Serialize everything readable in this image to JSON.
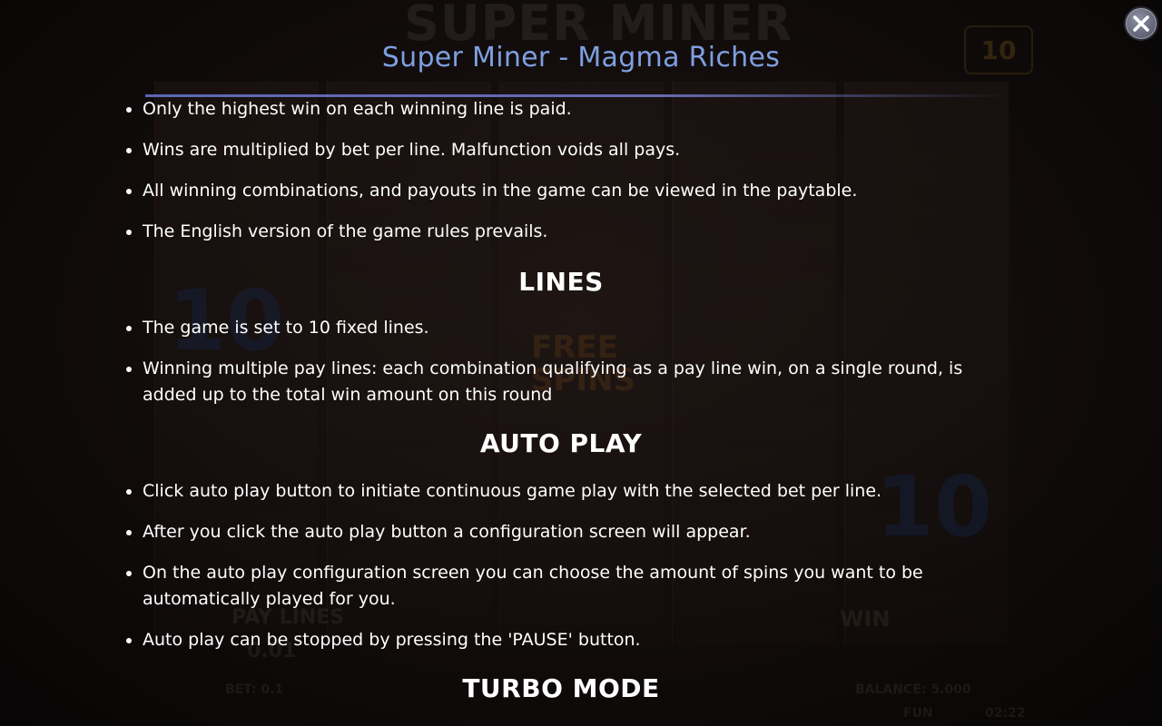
{
  "header": {
    "title": "Super Miner - Magma Riches"
  },
  "close_icon": "close-icon",
  "intro_rules": [
    "Only the highest win on each winning line is paid.",
    "Wins are multiplied by bet per line. Malfunction voids all pays.",
    "All winning combinations, and payouts in the game can be viewed in the paytable.",
    "The English version of the game rules prevails."
  ],
  "lines_section": {
    "title": "LINES",
    "items": [
      "The game is set to 10 fixed lines.",
      "Winning multiple pay lines: each combination qualifying as a pay line win, on a single round, is added up to the total win amount on this round"
    ]
  },
  "auto_play_section": {
    "title": "AUTO PLAY",
    "items": [
      "Click auto play button to initiate continuous game play with the selected bet per line.",
      "After you click the auto play button a configuration screen will appear.",
      "On the auto play configuration screen you can choose the amount of spins you want to be automatically played for you.",
      "Auto play can be stopped by pressing the 'PAUSE' button."
    ]
  },
  "turbo_section": {
    "title": "TURBO MODE"
  },
  "background": {
    "game_logo": "SUPER MINER",
    "lines_badge": "10",
    "free_spins_text": "FREE SPINS",
    "symbol_ten": "10",
    "paylines_label": "PAY LINES",
    "paylines_value": "0.01",
    "win_label": "WIN",
    "bet_text": "BET: 0.1",
    "balance_text": "BALANCE: 5.000",
    "fun_text": "FUN",
    "clock_text": "02:22"
  },
  "colors": {
    "title": "#7e9fe0",
    "text": "#ffffff",
    "rule": "#606cbe"
  }
}
